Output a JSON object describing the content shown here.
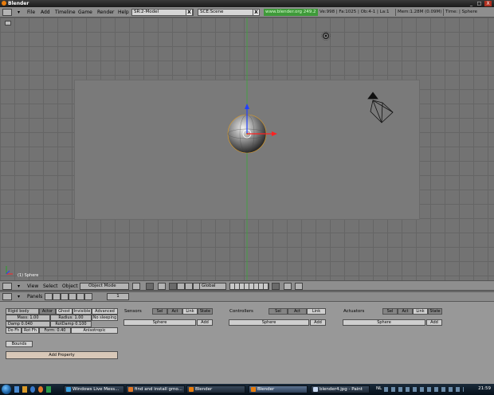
{
  "window": {
    "title": "Blender",
    "min": "_",
    "max": "□",
    "close": "X"
  },
  "infobar": {
    "menus": [
      "File",
      "Add",
      "Timeline",
      "Game",
      "Render",
      "Help"
    ],
    "screen_field": "SR:2-Model",
    "scene_field": "SCE:Scene",
    "close_x": "X",
    "url": "www.blender.org 249.2",
    "stats": "Ve:998 | Fa:1025 | Ob:4-1 | La:1",
    "mem": "Mem:1.28M (0.09M)",
    "time": "Time: | Sphere"
  },
  "viewport": {
    "object_label": "(1) Sphere"
  },
  "view3d_header": {
    "view": "View",
    "select": "Select",
    "object": "Object",
    "mode": "Object Mode",
    "orientation": "Global"
  },
  "buttons": {
    "panels_label": "Panels",
    "frame": "1",
    "physics": {
      "type": "Rigid body",
      "actor": "Actor",
      "ghost": "Ghost",
      "invisible": "Invisible",
      "advanced": "Advanced",
      "mass": "Mass: 1.00",
      "radius": "Radius: 1.00",
      "no_sleeping": "No sleeping",
      "damp": "Damp 0.040",
      "rotdamp": "RotDamp 0.100",
      "do_fh": "Do Fh",
      "rot_fh": "Rot Fh",
      "form": "Form: 0.40",
      "anisotropic": "Anisotropic",
      "bounds": "Bounds",
      "add_property": "Add Property"
    },
    "sensors": {
      "title": "Sensors",
      "sel": "Sel",
      "act": "Act",
      "link": "Link",
      "state": "State",
      "object": "Sphere",
      "add": "Add"
    },
    "controllers": {
      "title": "Controllers",
      "sel": "Sel",
      "act": "Act",
      "link": "Link",
      "object": "Sphere",
      "add": "Add"
    },
    "actuators": {
      "title": "Actuators",
      "sel": "Sel",
      "act": "Act",
      "link": "Link",
      "state": "State",
      "object": "Sphere",
      "add": "Add"
    }
  },
  "taskbar": {
    "tasks": [
      "Windows Live Mess...",
      "find and install gmo...",
      "Blender",
      "Blender",
      "blender4.jpg - Paint"
    ],
    "lang": "NL",
    "clock": "21:59"
  },
  "colors": {
    "viewport_bg": "#737373",
    "url_green": "#3f9a3a",
    "axis_x": "#ff2020",
    "axis_y": "#2aa02a",
    "axis_z": "#2040ff"
  }
}
